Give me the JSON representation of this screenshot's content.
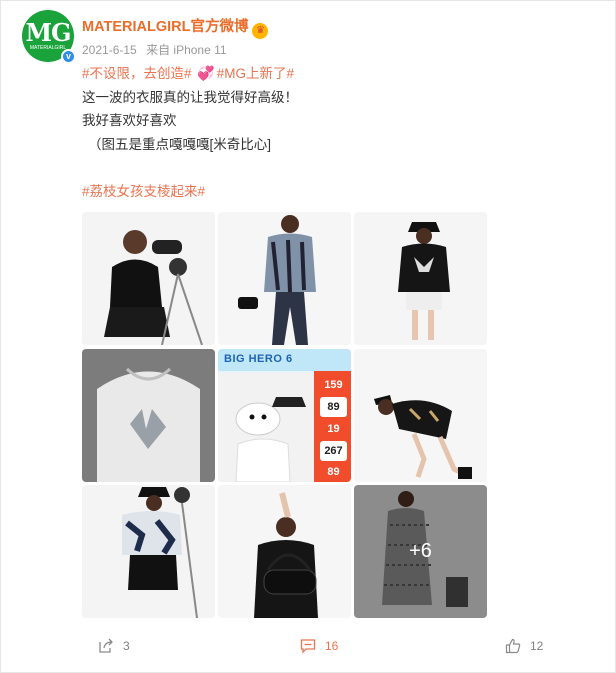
{
  "user": {
    "avatar_logo": "MG",
    "avatar_small": "MATERIALGIRL",
    "name": "MATERIALGIRL官方微博",
    "verified": "v"
  },
  "meta": {
    "date": "2021-6-15",
    "source": "来自 iPhone 11"
  },
  "post": {
    "topic1": "#不设限，去创造#",
    "topic2": "#MG上新了#",
    "line2": "这一波的衣服真的让我觉得好高级！",
    "line3": "我好喜欢好喜欢",
    "line4": "（图五是重点嘎嘎嘎[米奇比心]",
    "topic3": "#荔枝女孩支棱起来#"
  },
  "images": {
    "promo_title": "BIG HERO 6",
    "prices": [
      "159",
      "89",
      "19",
      "267",
      "89"
    ],
    "more_label": "+6"
  },
  "footer": {
    "share_count": "3",
    "comment_count": "16",
    "like_count": "12"
  },
  "colors": {
    "accent": "#eb7350",
    "username": "#eb6d2c",
    "avatar_bg": "#1aa33a",
    "verified": "#2e8ee8"
  },
  "icons": [
    "verified-badge-icon",
    "crown-emoji-icon",
    "heart-emoji-icon",
    "share-icon",
    "comment-icon",
    "like-icon"
  ]
}
